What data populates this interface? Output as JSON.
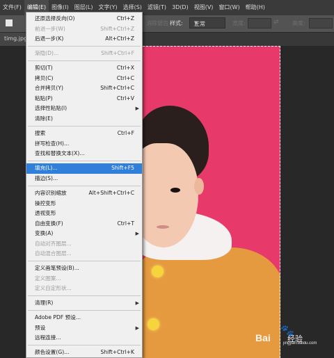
{
  "menubar": {
    "items": [
      "文件(F)",
      "编辑(E)",
      "图像(I)",
      "图层(L)",
      "文字(Y)",
      "选择(S)",
      "滤镜(T)",
      "3D(D)",
      "视图(V)",
      "窗口(W)",
      "帮助(H)"
    ]
  },
  "optionsbar": {
    "faded_label": "消除锯齿",
    "style_label": "样式:",
    "style_value": "正常",
    "width_label": "宽度:",
    "height_label": "高度:"
  },
  "tab": {
    "filename": "timg.jpg"
  },
  "menu": {
    "items": [
      {
        "label": "还原选择反向(O)",
        "shortcut": "Ctrl+Z",
        "disabled": false
      },
      {
        "label": "前进一步(W)",
        "shortcut": "Shift+Ctrl+Z",
        "disabled": true
      },
      {
        "label": "后退一步(K)",
        "shortcut": "Alt+Ctrl+Z",
        "disabled": false
      },
      {
        "label": "渐隐(D)...",
        "shortcut": "Shift+Ctrl+F",
        "disabled": true
      },
      {
        "label": "剪切(T)",
        "shortcut": "Ctrl+X",
        "disabled": false
      },
      {
        "label": "拷贝(C)",
        "shortcut": "Ctrl+C",
        "disabled": false
      },
      {
        "label": "合并拷贝(Y)",
        "shortcut": "Shift+Ctrl+C",
        "disabled": false
      },
      {
        "label": "粘贴(P)",
        "shortcut": "Ctrl+V",
        "disabled": false
      },
      {
        "label": "选择性粘贴(I)",
        "shortcut": "",
        "disabled": false,
        "submenu": true
      },
      {
        "label": "清除(E)",
        "shortcut": "",
        "disabled": false
      },
      {
        "label": "搜索",
        "shortcut": "Ctrl+F",
        "disabled": false
      },
      {
        "label": "拼写检查(H)...",
        "shortcut": "",
        "disabled": false
      },
      {
        "label": "查找和替换文本(X)...",
        "shortcut": "",
        "disabled": false
      },
      {
        "label": "填充(L)...",
        "shortcut": "Shift+F5",
        "disabled": false,
        "highlighted": true
      },
      {
        "label": "描边(S)...",
        "shortcut": "",
        "disabled": false
      },
      {
        "label": "内容识别缩放",
        "shortcut": "Alt+Shift+Ctrl+C",
        "disabled": false
      },
      {
        "label": "操控变形",
        "shortcut": "",
        "disabled": false
      },
      {
        "label": "透视变形",
        "shortcut": "",
        "disabled": false
      },
      {
        "label": "自由变换(F)",
        "shortcut": "Ctrl+T",
        "disabled": false
      },
      {
        "label": "变换(A)",
        "shortcut": "",
        "disabled": false,
        "submenu": true
      },
      {
        "label": "自动对齐图层...",
        "shortcut": "",
        "disabled": true
      },
      {
        "label": "自动混合图层...",
        "shortcut": "",
        "disabled": true
      },
      {
        "label": "定义画笔预设(B)...",
        "shortcut": "",
        "disabled": false
      },
      {
        "label": "定义图案...",
        "shortcut": "",
        "disabled": true
      },
      {
        "label": "定义自定形状...",
        "shortcut": "",
        "disabled": true
      },
      {
        "label": "清理(R)",
        "shortcut": "",
        "disabled": false,
        "submenu": true
      },
      {
        "label": "Adobe PDF 预设...",
        "shortcut": "",
        "disabled": false
      },
      {
        "label": "预设",
        "shortcut": "",
        "disabled": false,
        "submenu": true
      },
      {
        "label": "远程连接...",
        "shortcut": "",
        "disabled": false
      },
      {
        "label": "颜色设置(G)...",
        "shortcut": "Shift+Ctrl+K",
        "disabled": false
      }
    ]
  },
  "watermark": {
    "brand": "Bai",
    "brand2": "经验",
    "url": "jingyan.baidu.com"
  },
  "colors": {
    "accent": "#2f7fdb",
    "photo_bg": "#e8396b",
    "menubar": "#3a3a3a"
  }
}
